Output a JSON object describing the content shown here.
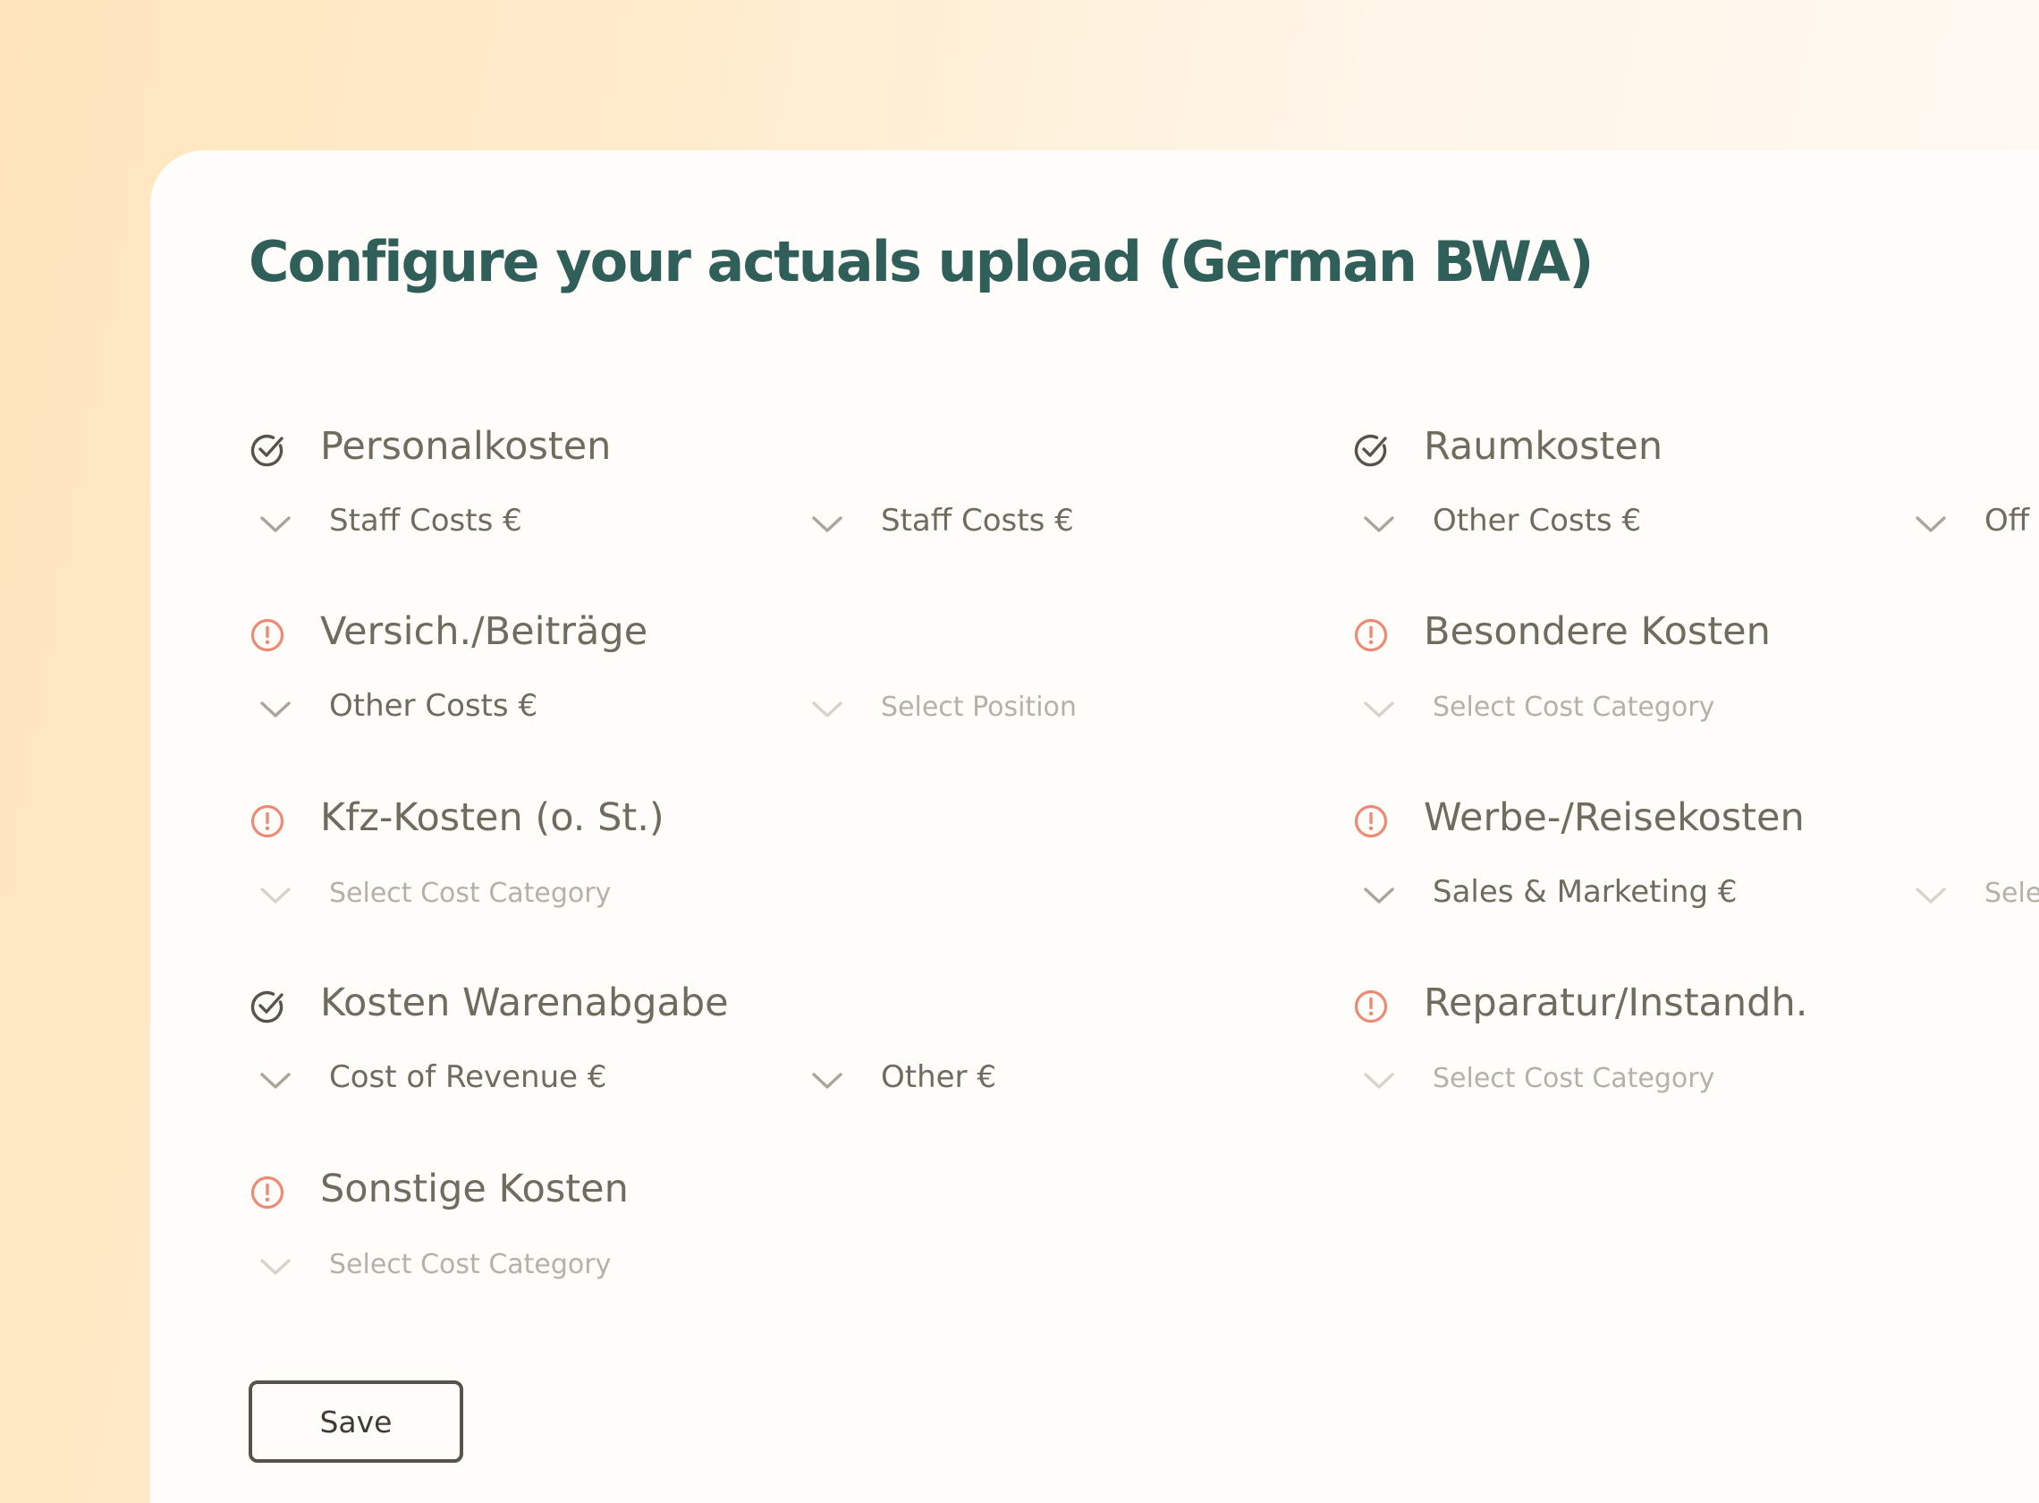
{
  "page": {
    "title": "Configure your actuals upload (German BWA)"
  },
  "sections": {
    "personalkosten": {
      "name": "Personalkosten",
      "status": "complete",
      "select1": "Staff Costs €",
      "select2": "Staff Costs €"
    },
    "versich": {
      "name": "Versich./Beiträge",
      "status": "warning",
      "select1": "Other Costs €",
      "select2_placeholder": "Select Position"
    },
    "kfz": {
      "name": "Kfz-Kosten (o. St.)",
      "status": "warning",
      "select1_placeholder": "Select Cost Category"
    },
    "warenabgabe": {
      "name": "Kosten Warenabgabe",
      "status": "complete",
      "select1": "Cost of Revenue €",
      "select2": "Other €"
    },
    "sonstige": {
      "name": "Sonstige Kosten",
      "status": "warning",
      "select1_placeholder": "Select Cost Category"
    },
    "raumkosten": {
      "name": "Raumkosten",
      "status": "complete",
      "select1": "Other Costs €",
      "select2": "Off"
    },
    "besondere": {
      "name": "Besondere Kosten",
      "status": "warning",
      "select1_placeholder": "Select Cost Category"
    },
    "werbe": {
      "name": "Werbe-/Reisekosten",
      "status": "warning",
      "select1": "Sales & Marketing €",
      "select2_placeholder": "Sele"
    },
    "reparatur": {
      "name": "Reparatur/Instandh.",
      "status": "warning",
      "select1_placeholder": "Select Cost Category"
    }
  },
  "icons": {
    "complete": "check-circle-icon",
    "warning": "alert-circle-icon",
    "dropdown": "chevron-down-icon"
  },
  "colors": {
    "title": "#2f5f58",
    "text": "#6e6b5f",
    "placeholder": "#b4b1a8",
    "warning": "#ee8a73",
    "check": "#55534b",
    "panel": "#fffdfa"
  },
  "actions": {
    "save_label": "Save"
  }
}
